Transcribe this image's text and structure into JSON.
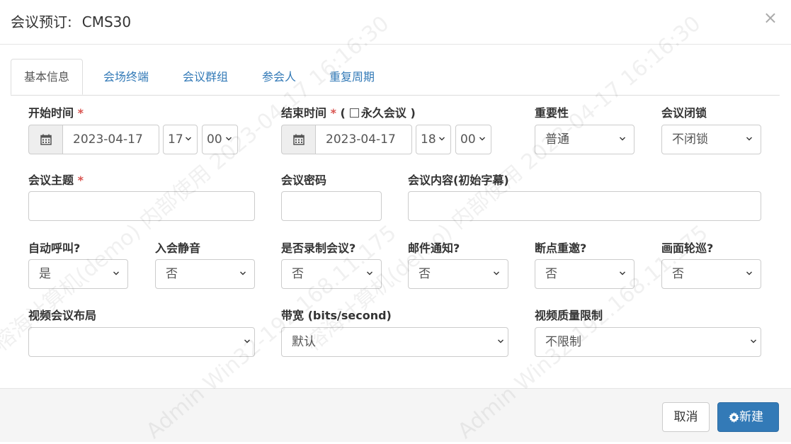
{
  "dialog": {
    "title": "会议预订:",
    "name": "CMS30",
    "close_symbol": "×"
  },
  "tabs": [
    "基本信息",
    "会场终端",
    "会议群组",
    "参会人",
    "重复周期"
  ],
  "form": {
    "start_label": "开始时间",
    "start_date": "2023-04-17",
    "start_hour": "17",
    "start_min": "00",
    "end_label": "结束时间",
    "end_paren_open": "(",
    "end_paren_close": ")",
    "permanent_label": "永久会议",
    "end_date": "2023-04-17",
    "end_hour": "18",
    "end_min": "00",
    "importance_label": "重要性",
    "importance_value": "普通",
    "lock_label": "会议闭锁",
    "lock_value": "不闭锁",
    "subject_label": "会议主题",
    "subject_value": "",
    "password_label": "会议密码",
    "password_value": "",
    "content_label": "会议内容(初始字幕)",
    "content_value": "",
    "autocall_label": "自动呼叫?",
    "autocall_value": "是",
    "mute_label": "入会静音",
    "mute_value": "否",
    "record_label": "是否录制会议?",
    "record_value": "否",
    "email_label": "邮件通知?",
    "email_value": "否",
    "reinvite_label": "断点重邀?",
    "reinvite_value": "否",
    "patrol_label": "画面轮巡?",
    "patrol_value": "否",
    "layout_label": "视频会议布局",
    "layout_value": "",
    "bandwidth_label": "带宽 (bits/second)",
    "bandwidth_value": "默认",
    "quality_label": "视频质量限制",
    "quality_value": "不限制",
    "required_mark": "*"
  },
  "footer": {
    "cancel": "取消",
    "create": "新建"
  },
  "watermark": {
    "line1": "榕海计算机(demo) 内部使用 2023-04-17 16:16:30",
    "line2": "Admin Win32-192.168.11.175"
  },
  "colors": {
    "primary": "#337ab7",
    "required": "#d9534f"
  }
}
